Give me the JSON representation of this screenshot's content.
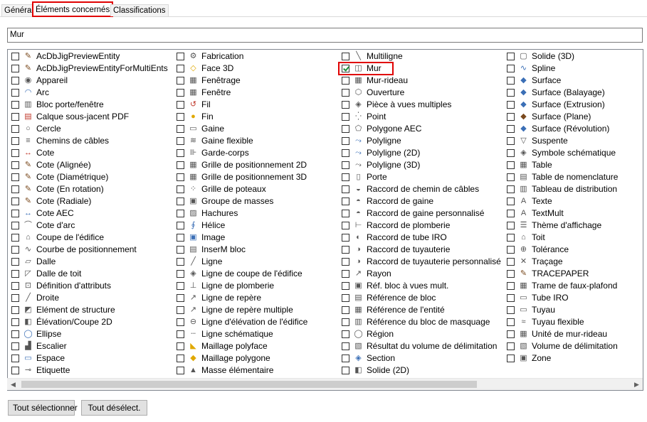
{
  "tabs": [
    "Général",
    "Éléments concernés",
    "Classifications"
  ],
  "search": {
    "value": "Mur"
  },
  "columns": [
    [
      {
        "label": "AcDbJigPreviewEntity",
        "icon": "brush-icon",
        "checked": false
      },
      {
        "label": "AcDbJigPreviewEntityForMultiEnts",
        "icon": "brush-icon",
        "checked": false
      },
      {
        "label": "Appareil",
        "icon": "device-icon",
        "checked": false
      },
      {
        "label": "Arc",
        "icon": "arc-icon",
        "checked": false
      },
      {
        "label": "Bloc porte/fenêtre",
        "icon": "door-window-block-icon",
        "checked": false
      },
      {
        "label": "Calque sous-jacent PDF",
        "icon": "pdf-icon",
        "checked": false
      },
      {
        "label": "Cercle",
        "icon": "circle-icon",
        "checked": false
      },
      {
        "label": "Chemins de câbles",
        "icon": "cable-tray-icon",
        "checked": false
      },
      {
        "label": "Cote",
        "icon": "dimension-icon",
        "checked": false
      },
      {
        "label": "Cote (Alignée)",
        "icon": "brush-icon",
        "checked": false
      },
      {
        "label": "Cote (Diamétrique)",
        "icon": "brush-icon",
        "checked": false
      },
      {
        "label": "Cote (En rotation)",
        "icon": "brush-icon",
        "checked": false
      },
      {
        "label": "Cote (Radiale)",
        "icon": "brush-icon",
        "checked": false
      },
      {
        "label": "Cote AEC",
        "icon": "aec-dimension-icon",
        "checked": false
      },
      {
        "label": "Cote d'arc",
        "icon": "arc-dimension-icon",
        "checked": false
      },
      {
        "label": "Coupe de l'édifice",
        "icon": "building-section-icon",
        "checked": false
      },
      {
        "label": "Courbe de positionnement",
        "icon": "layout-curve-icon",
        "checked": false
      },
      {
        "label": "Dalle",
        "icon": "slab-icon",
        "checked": false
      },
      {
        "label": "Dalle de toit",
        "icon": "roof-slab-icon",
        "checked": false
      },
      {
        "label": "Définition d'attributs",
        "icon": "attribute-definition-icon",
        "checked": false
      },
      {
        "label": "Droite",
        "icon": "line-icon",
        "checked": false
      },
      {
        "label": "Elément de structure",
        "icon": "structural-member-icon",
        "checked": false
      },
      {
        "label": "Élévation/Coupe 2D",
        "icon": "elevation-icon",
        "checked": false
      },
      {
        "label": "Ellipse",
        "icon": "ellipse-icon",
        "checked": false
      },
      {
        "label": "Escalier",
        "icon": "stair-icon",
        "checked": false
      },
      {
        "label": "Espace",
        "icon": "space-icon",
        "checked": false
      },
      {
        "label": "Etiquette",
        "icon": "tag-icon",
        "checked": false
      }
    ],
    [
      {
        "label": "Fabrication",
        "icon": "fabrication-icon",
        "checked": false
      },
      {
        "label": "Face 3D",
        "icon": "face3d-icon",
        "checked": false
      },
      {
        "label": "Fenêtrage",
        "icon": "window-assembly-icon",
        "checked": false
      },
      {
        "label": "Fenêtre",
        "icon": "window-icon",
        "checked": false
      },
      {
        "label": "Fil",
        "icon": "wire-icon",
        "checked": false
      },
      {
        "label": "Fin",
        "icon": "bulb-icon",
        "checked": false
      },
      {
        "label": "Gaine",
        "icon": "duct-icon",
        "checked": false
      },
      {
        "label": "Gaine flexible",
        "icon": "flex-duct-icon",
        "checked": false
      },
      {
        "label": "Garde-corps",
        "icon": "railing-icon",
        "checked": false
      },
      {
        "label": "Grille de positionnement 2D",
        "icon": "grid-icon",
        "checked": false
      },
      {
        "label": "Grille de positionnement 3D",
        "icon": "grid-icon",
        "checked": false
      },
      {
        "label": "Grille de poteaux",
        "icon": "column-grid-icon",
        "checked": false
      },
      {
        "label": "Groupe de masses",
        "icon": "mass-group-icon",
        "checked": false
      },
      {
        "label": "Hachures",
        "icon": "hatch-icon",
        "checked": false
      },
      {
        "label": "Hélice",
        "icon": "helix-icon",
        "checked": false
      },
      {
        "label": "Image",
        "icon": "image-icon",
        "checked": false
      },
      {
        "label": "InserM bloc",
        "icon": "block-insert-icon",
        "checked": false
      },
      {
        "label": "Ligne",
        "icon": "line-icon",
        "checked": false
      },
      {
        "label": "Ligne de coupe de l'édifice",
        "icon": "section-line-icon",
        "checked": false
      },
      {
        "label": "Ligne de plomberie",
        "icon": "plumbing-line-icon",
        "checked": false
      },
      {
        "label": "Ligne de repère",
        "icon": "leader-icon",
        "checked": false
      },
      {
        "label": "Ligne de repère multiple",
        "icon": "multileader-icon",
        "checked": false
      },
      {
        "label": "Ligne d'élévation de l'édifice",
        "icon": "elevation-line-icon",
        "checked": false
      },
      {
        "label": "Ligne schématique",
        "icon": "schematic-line-icon",
        "checked": false
      },
      {
        "label": "Maillage polyface",
        "icon": "polyface-mesh-icon",
        "checked": false
      },
      {
        "label": "Maillage polygone",
        "icon": "polygon-mesh-icon",
        "checked": false
      },
      {
        "label": "Masse élémentaire",
        "icon": "mass-element-icon",
        "checked": false
      }
    ],
    [
      {
        "label": "Multiligne",
        "icon": "multiline-icon",
        "checked": false
      },
      {
        "label": "Mur",
        "icon": "wall-icon",
        "checked": true
      },
      {
        "label": "Mur-rideau",
        "icon": "curtain-wall-icon",
        "checked": false
      },
      {
        "label": "Ouverture",
        "icon": "opening-icon",
        "checked": false
      },
      {
        "label": "Pièce à vues multiples",
        "icon": "multi-view-part-icon",
        "checked": false
      },
      {
        "label": "Point",
        "icon": "point-icon",
        "checked": false
      },
      {
        "label": "Polygone AEC",
        "icon": "polygon-icon",
        "checked": false
      },
      {
        "label": "Polyligne",
        "icon": "polyline-icon",
        "checked": false
      },
      {
        "label": "Polyligne (2D)",
        "icon": "polyline-icon",
        "checked": false
      },
      {
        "label": "Polyligne (3D)",
        "icon": "polyline3d-icon",
        "checked": false
      },
      {
        "label": "Porte",
        "icon": "door-icon",
        "checked": false
      },
      {
        "label": "Raccord de chemin de câbles",
        "icon": "cable-tray-fitting-icon",
        "checked": false
      },
      {
        "label": "Raccord de gaine",
        "icon": "duct-fitting-icon",
        "checked": false
      },
      {
        "label": "Raccord de gaine personnalisé",
        "icon": "custom-duct-fitting-icon",
        "checked": false
      },
      {
        "label": "Raccord de plomberie",
        "icon": "plumbing-fitting-icon",
        "checked": false
      },
      {
        "label": "Raccord de tube IRO",
        "icon": "conduit-fitting-icon",
        "checked": false
      },
      {
        "label": "Raccord de tuyauterie",
        "icon": "pipe-fitting-icon",
        "checked": false
      },
      {
        "label": "Raccord de tuyauterie personnalisé",
        "icon": "custom-pipe-fitting-icon",
        "checked": false
      },
      {
        "label": "Rayon",
        "icon": "ray-icon",
        "checked": false
      },
      {
        "label": "Réf. bloc à vues mult.",
        "icon": "multi-view-block-icon",
        "checked": false
      },
      {
        "label": "Référence de bloc",
        "icon": "block-reference-icon",
        "checked": false
      },
      {
        "label": "Référence de l'entité",
        "icon": "entity-reference-icon",
        "checked": false
      },
      {
        "label": "Référence du bloc de masquage",
        "icon": "mask-block-icon",
        "checked": false
      },
      {
        "label": "Région",
        "icon": "region-icon",
        "checked": false
      },
      {
        "label": "Résultat du volume de délimitation",
        "icon": "bounding-volume-icon",
        "checked": false
      },
      {
        "label": "Section",
        "icon": "section-icon",
        "checked": false
      },
      {
        "label": "Solide (2D)",
        "icon": "solid2d-icon",
        "checked": false
      }
    ],
    [
      {
        "label": "Solide (3D)",
        "icon": "solid3d-icon",
        "checked": false
      },
      {
        "label": "Spline",
        "icon": "spline-icon",
        "checked": false
      },
      {
        "label": "Surface",
        "icon": "surface-icon",
        "checked": false
      },
      {
        "label": "Surface (Balayage)",
        "icon": "surface-icon",
        "checked": false
      },
      {
        "label": "Surface (Extrusion)",
        "icon": "surface-icon",
        "checked": false
      },
      {
        "label": "Surface (Plane)",
        "icon": "plane-surface-icon",
        "checked": false
      },
      {
        "label": "Surface (Révolution)",
        "icon": "revolved-surface-icon",
        "checked": false
      },
      {
        "label": "Suspente",
        "icon": "hanger-icon",
        "checked": false
      },
      {
        "label": "Symbole schématique",
        "icon": "schematic-symbol-icon",
        "checked": false
      },
      {
        "label": "Table",
        "icon": "table-icon",
        "checked": false
      },
      {
        "label": "Table de nomenclature",
        "icon": "schedule-table-icon",
        "checked": false
      },
      {
        "label": "Tableau de distribution",
        "icon": "panel-icon",
        "checked": false
      },
      {
        "label": "Texte",
        "icon": "text-icon",
        "checked": false
      },
      {
        "label": "TextMult",
        "icon": "mtext-icon",
        "checked": false
      },
      {
        "label": "Thème d'affichage",
        "icon": "display-theme-icon",
        "checked": false
      },
      {
        "label": "Toit",
        "icon": "roof-icon",
        "checked": false
      },
      {
        "label": "Tolérance",
        "icon": "tolerance-icon",
        "checked": false
      },
      {
        "label": "Traçage",
        "icon": "trace-icon",
        "checked": false
      },
      {
        "label": "TRACEPAPER",
        "icon": "brush-icon",
        "checked": false
      },
      {
        "label": "Trame de faux-plafond",
        "icon": "ceiling-grid-icon",
        "checked": false
      },
      {
        "label": "Tube IRO",
        "icon": "conduit-icon",
        "checked": false
      },
      {
        "label": "Tuyau",
        "icon": "pipe-icon",
        "checked": false
      },
      {
        "label": "Tuyau flexible",
        "icon": "flex-pipe-icon",
        "checked": false
      },
      {
        "label": "Unité de mur-rideau",
        "icon": "curtain-wall-unit-icon",
        "checked": false
      },
      {
        "label": "Volume de délimitation",
        "icon": "bounding-volume-icon",
        "checked": false
      },
      {
        "label": "Zone",
        "icon": "zone-icon",
        "checked": false
      }
    ]
  ],
  "buttons": {
    "select_all": "Tout sélectionner",
    "deselect_all": "Tout désélect."
  },
  "colors": {
    "highlight": "#e00000",
    "check": "#1f8f3a"
  }
}
